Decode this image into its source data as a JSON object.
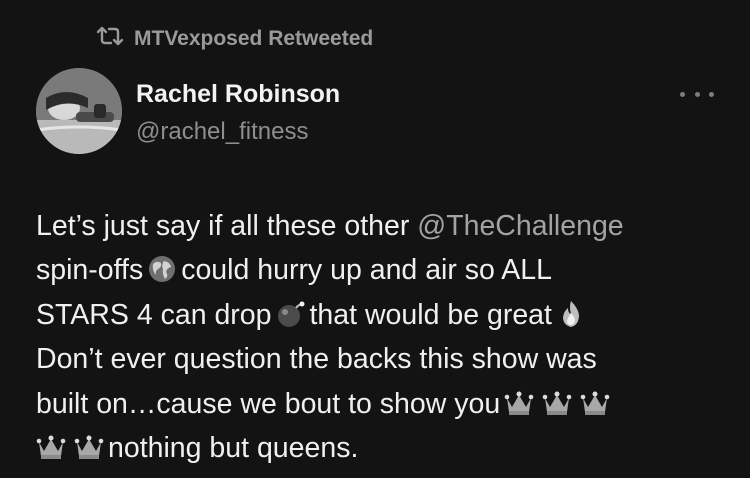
{
  "retweet": {
    "icon": "retweet-icon",
    "label": "MTVexposed Retweeted"
  },
  "author": {
    "display_name": "Rachel Robinson",
    "handle": "@rachel_fitness",
    "avatar": "profile-photo"
  },
  "more_icon": "more-options-icon",
  "body": {
    "l1_pre": "Let’s just say if all these other",
    "mention": "@TheChallenge",
    "l2_a": "spin-offs",
    "l2_b": "could hurry up and air so ALL",
    "l3_a": "STARS 4 can drop",
    "l3_b": "that would be great",
    "l4": "Don’t ever question the backs this show was",
    "l5": "built on…cause we bout to show you",
    "l6": "nothing but queens.",
    "emoji_names": [
      "globe-emoji",
      "bomb-emoji",
      "fire-emoji",
      "crown-emoji"
    ]
  },
  "colors": {
    "background": "#131313",
    "text": "#f0f0f0",
    "secondary": "#8e8e8e",
    "mention": "#a3a3a3"
  }
}
